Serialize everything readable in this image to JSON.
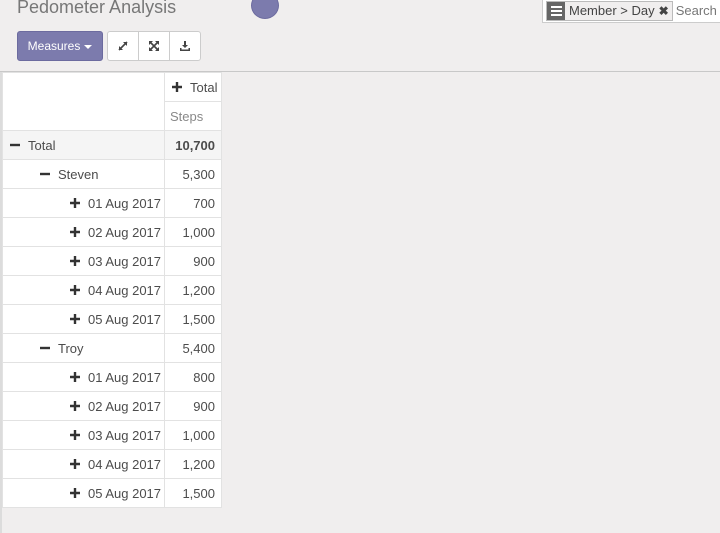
{
  "header": {
    "title": "Pedometer Analysis"
  },
  "search": {
    "facet_label": "Member > Day",
    "placeholder": "Search"
  },
  "toolbar": {
    "measures_label": "Measures"
  },
  "pivot": {
    "column_header": "Total",
    "measure": "Steps",
    "rows": [
      {
        "label": "Total",
        "value": "10,700"
      },
      {
        "label": "Steven",
        "value": "5,300"
      },
      {
        "label": "01 Aug 2017",
        "value": "700"
      },
      {
        "label": "02 Aug 2017",
        "value": "1,000"
      },
      {
        "label": "03 Aug 2017",
        "value": "900"
      },
      {
        "label": "04 Aug 2017",
        "value": "1,200"
      },
      {
        "label": "05 Aug 2017",
        "value": "1,500"
      },
      {
        "label": "Troy",
        "value": "5,400"
      },
      {
        "label": "01 Aug 2017",
        "value": "800"
      },
      {
        "label": "02 Aug 2017",
        "value": "900"
      },
      {
        "label": "03 Aug 2017",
        "value": "1,000"
      },
      {
        "label": "04 Aug 2017",
        "value": "1,200"
      },
      {
        "label": "05 Aug 2017",
        "value": "1,500"
      }
    ]
  },
  "colors": {
    "accent": "#7c7bad",
    "background": "#f0eeee"
  }
}
